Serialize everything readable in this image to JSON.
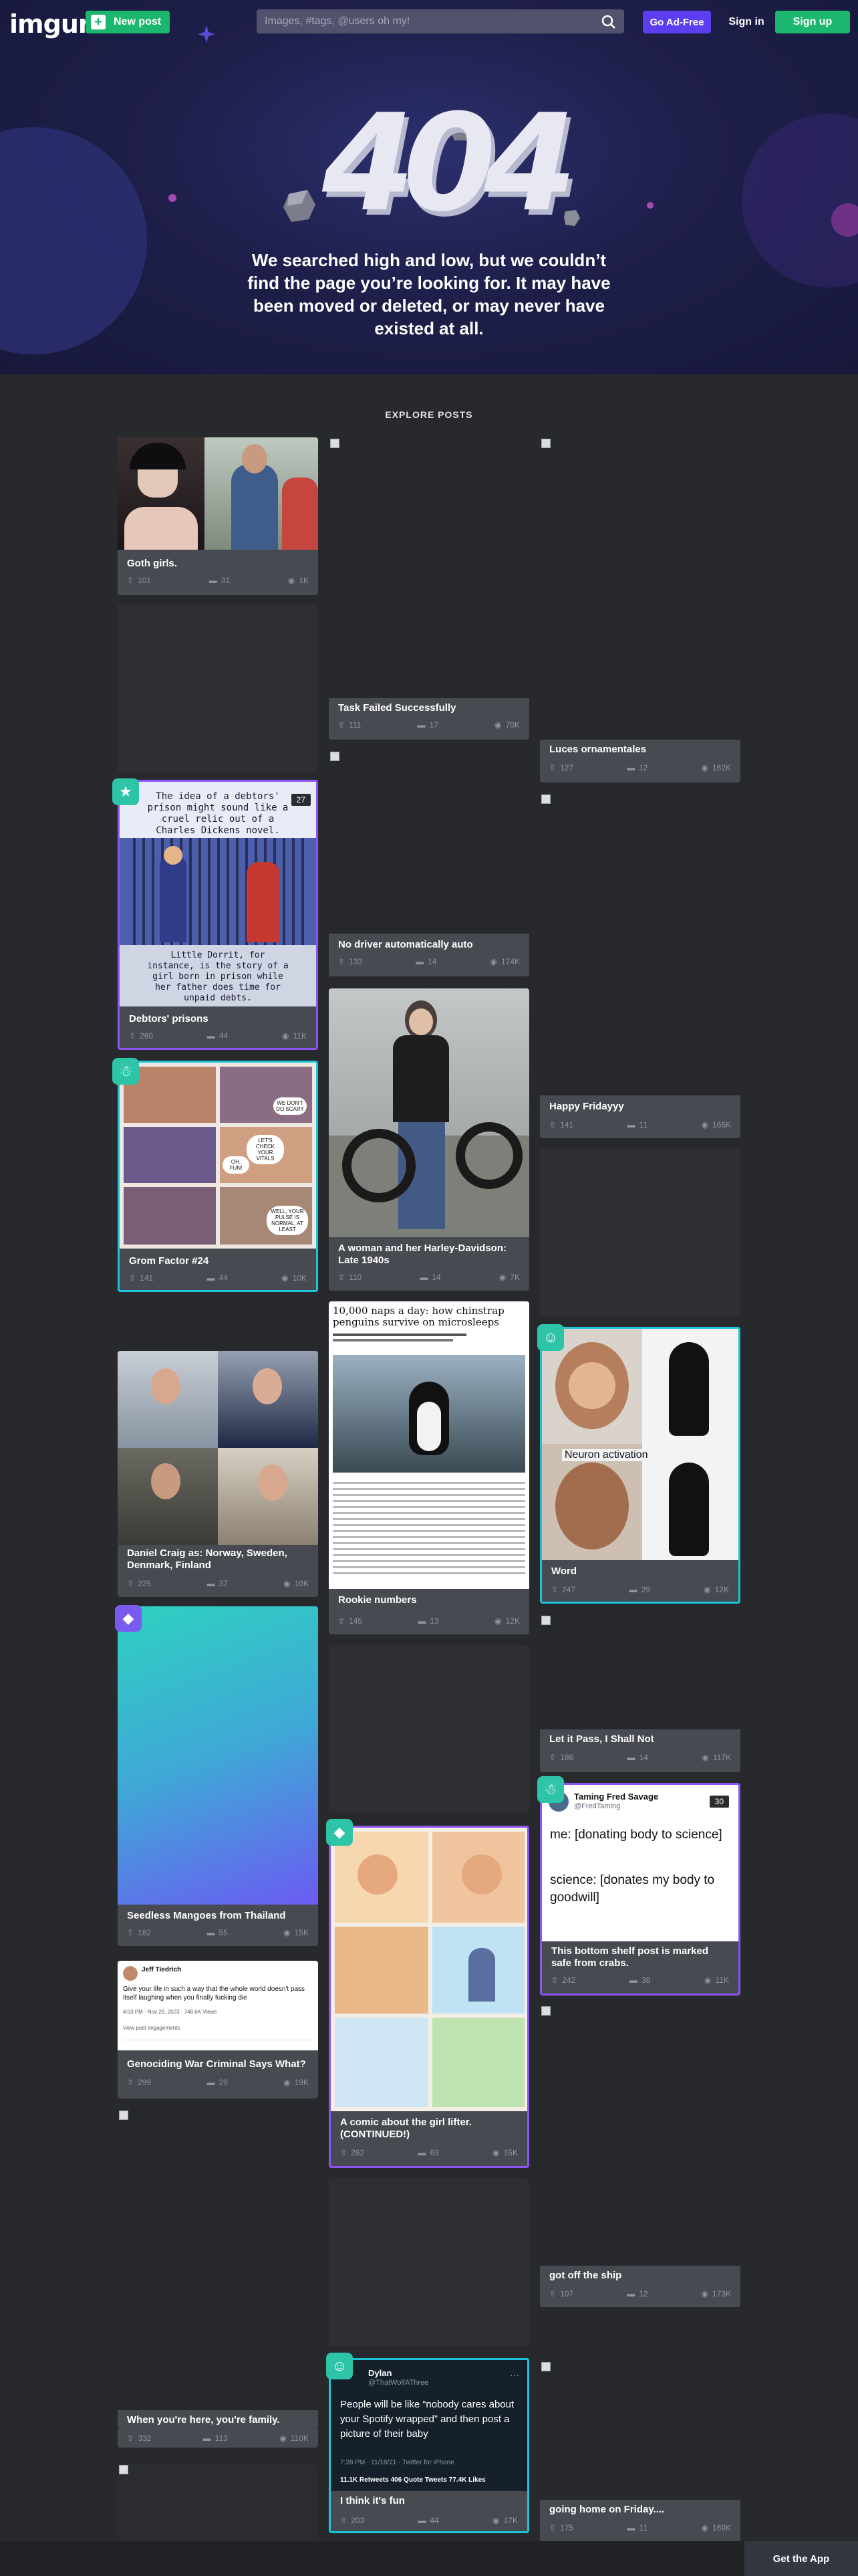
{
  "header": {
    "logo": "imgur",
    "new_post_label": "New post",
    "search_placeholder": "Images, #tags, @users oh my!",
    "ad_free_label": "Go Ad-Free",
    "sign_in_label": "Sign in",
    "sign_up_label": "Sign up"
  },
  "hero": {
    "code": "404",
    "message": "We searched high and low, but we couldn’t find the page you’re looking for. It may have been moved or deleted, or may never have existed at all."
  },
  "explore": {
    "title": "EXPLORE POSTS"
  },
  "posts": [
    {
      "title": "Goth girls.",
      "upvotes": "101",
      "comments": "31",
      "views": "1K"
    },
    {
      "title": "Task Failed Successfully",
      "upvotes": "111",
      "comments": "17",
      "views": "70K"
    },
    {
      "title": "Luces ornamentales",
      "upvotes": "127",
      "comments": "12",
      "views": "162K"
    },
    {
      "title": "No driver automatically auto",
      "upvotes": "133",
      "comments": "14",
      "views": "174K"
    },
    {
      "title": "Debtors' prisons",
      "upvotes": "260",
      "comments": "44",
      "views": "11K"
    },
    {
      "title": "Happy Fridayyy",
      "upvotes": "141",
      "comments": "11",
      "views": "166K"
    },
    {
      "title": "A woman and her Harley-Davidson: Late 1940s",
      "upvotes": "110",
      "comments": "14",
      "views": "7K"
    },
    {
      "title": "Grom Factor #24",
      "upvotes": "141",
      "comments": "44",
      "views": "10K"
    },
    {
      "title": "Word",
      "upvotes": "247",
      "comments": "29",
      "views": "12K"
    },
    {
      "title": "Daniel Craig as: Norway, Sweden, Denmark, Finland",
      "upvotes": "225",
      "comments": "37",
      "views": "10K"
    },
    {
      "title": "Rookie numbers",
      "upvotes": "145",
      "comments": "13",
      "views": "12K"
    },
    {
      "title": "Let it Pass, I Shall Not",
      "upvotes": "186",
      "comments": "14",
      "views": "117K"
    },
    {
      "title": "Seedless Mangoes from Thailand",
      "upvotes": "182",
      "comments": "55",
      "views": "15K"
    },
    {
      "title": "This bottom shelf post is marked safe from crabs.",
      "upvotes": "242",
      "comments": "38",
      "views": "11K"
    },
    {
      "title": "Genociding War Criminal Says What?",
      "upvotes": "299",
      "comments": "29",
      "views": "19K"
    },
    {
      "title": "A comic about the girl lifter. (CONTINUED!)",
      "upvotes": "262",
      "comments": "63",
      "views": "15K"
    },
    {
      "title": "got off the ship",
      "upvotes": "107",
      "comments": "12",
      "views": "173K"
    },
    {
      "title": "When you're here, you're family.",
      "upvotes": "332",
      "comments": "113",
      "views": "110K"
    },
    {
      "title": "I think it's fun",
      "upvotes": "203",
      "comments": "44",
      "views": "17K"
    },
    {
      "title": "going home on Friday....",
      "upvotes": "175",
      "comments": "11",
      "views": "169K"
    }
  ],
  "embedded": {
    "debtors_count": "27",
    "debtors_text_top": "The idea of a debtors' prison might sound like a cruel relic out of a Charles Dickens novel.",
    "debtors_text_bottom": "Little Dorrit, for instance, is the story of a girl born in prison while her father does time for unpaid debts.",
    "penguin_headline": "10,000 naps a day: how chinstrap penguins survive on microsleeps",
    "neuron_label": "Neuron activation",
    "crab_count": "30",
    "crab_author": "Taming Fred Savage",
    "crab_handle": "@FredTaming",
    "crab_line1": "me: [donating body to science]",
    "crab_line2": "science: [donates my body to goodwill]",
    "tweet_author": "Dylan",
    "tweet_handle": "@ThatWolfAThree",
    "tweet_text": "People will be like “nobody cares about your Spotify wrapped” and then post a picture of their baby",
    "tweet_meta": "7:28 PM · 11/18/21 · Twitter for iPhone",
    "tweet_stats": "11.1K Retweets  406 Quote Tweets  77.4K Likes",
    "genocide_author": "Jeff Tiedrich",
    "genocide_text": "Give your life in such a way that the whole world doesn't pass itself laughing when you finally fucking die",
    "genocide_meta": "4:03 PM · Nov 29, 2023 · 748.6K Views",
    "genocide_link": "View post engagements",
    "grom_bubble1": "WE DON'T DO SCARY",
    "grom_bubble2": "LET'S CHECK YOUR VITALS",
    "grom_bubble3": "OH, FUN!",
    "grom_bubble4": "WELL, YOUR PULSE IS NORMAL, AT LEAST"
  },
  "get_app_label": "Get the App",
  "colors": {
    "accent_green": "#1bb76e",
    "accent_purple": "#5c3df0",
    "promoted_border": "#8c54f5",
    "page_bg": "#27292d",
    "card_bg": "#474a51"
  }
}
